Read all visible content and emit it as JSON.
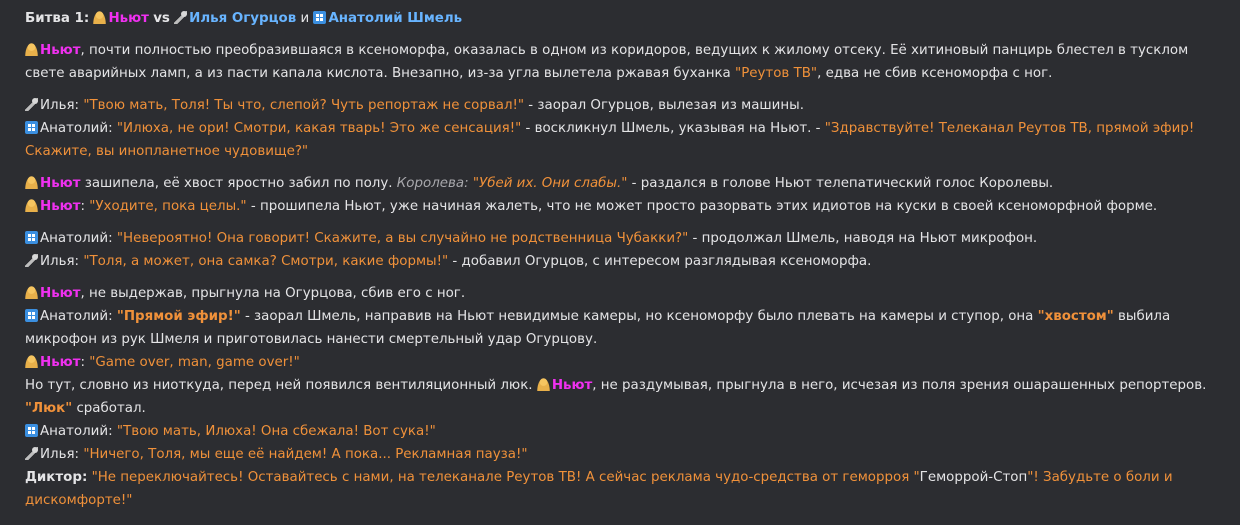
{
  "header": {
    "battle_label": "Битва 1:",
    "name1": "Ньют",
    "vs": "vs",
    "name2": "Илья Огурцов",
    "and": "и",
    "name3": "Анатолий Шмель"
  },
  "icons": {
    "woman": "woman-icon",
    "mic": "microphone-icon",
    "camera": "camera-icon"
  },
  "colors": {
    "background": "#2c2d31",
    "text": "#e4e4e6",
    "nyut": "#f030f0",
    "blue": "#68b4ff",
    "quote": "#f0913a",
    "gray": "#a8a8ac"
  },
  "lines": {
    "l1": {
      "name": "Ньют",
      "text": ", почти полностью преобразившаяся в ксеноморфа, оказалась в одном из коридоров, ведущих к жилому отсеку. Её хитиновый панцирь блестел в тусклом свете аварийных ламп, а из пасти капала кислота. Внезапно, из-за угла вылетела ржавая буханка ",
      "q1": "\"Реутов ТВ\"",
      "text2": ", едва не сбив ксеноморфа с ног."
    },
    "l2": {
      "sp": "Илья:",
      "q1": "\"Твою мать, Толя! Ты что, слепой? Чуть репортаж не сорвал!\"",
      "text": " - заорал Огурцов, вылезая из машины."
    },
    "l3": {
      "sp": "Анатолий:",
      "q1": "\"Илюха, не ори! Смотри, какая тварь! Это же сенсация!\"",
      "text": " - воскликнул Шмель, указывая на Ньют. - ",
      "q2": "\"Здравствуйте! Телеканал Реутов ТВ, прямой эфир! Скажите, вы инопланетное чудовище?\""
    },
    "l4": {
      "name": "Ньют",
      "text": " зашипела, её хвост яростно забил по полу. ",
      "queen": "Королева:",
      "q1": "\"Убей их. Они слабы.\"",
      "text2": " - раздался в голове Ньют телепатический голос Королевы."
    },
    "l5": {
      "name": "Ньют",
      "colon": ":",
      "q1": "\"Уходите, пока целы.\"",
      "text": " - прошипела Ньют, уже начиная жалеть, что не может просто разорвать этих идиотов на куски в своей ксеноморфной форме."
    },
    "l6": {
      "sp": "Анатолий:",
      "q1": "\"Невероятно! Она говорит! Скажите, а вы случайно не родственница Чубакки?\"",
      "text": " - продолжал Шмель, наводя на Ньют микрофон."
    },
    "l7": {
      "sp": "Илья:",
      "q1": "\"Толя, а может, она самка? Смотри, какие формы!\"",
      "text": " - добавил Огурцов, с интересом разглядывая ксеноморфа."
    },
    "l8": {
      "name": "Ньют",
      "text": ", не выдержав, прыгнула на Огурцова, сбив его с ног."
    },
    "l9": {
      "sp": "Анатолий:",
      "q1": "\"Прямой эфир!\"",
      "text": " - заорал Шмель, направив на Ньют невидимые камеры, но ксеноморфу было плевать на камеры и ступор, она ",
      "q2": "\"хвостом\"",
      "text2": " выбила микрофон из рук Шмеля и приготовилась нанести смертельный удар Огурцову."
    },
    "l10": {
      "name": "Ньют",
      "colon": ":",
      "q1": "\"Game over, man, game over!\""
    },
    "l11": {
      "text": "Но тут, словно из ниоткуда, перед ней появился вентиляционный люк. ",
      "name": "Ньют",
      "text2": ", не раздумывая, прыгнула в него, исчезая из поля зрения ошарашенных репортеров. ",
      "q1": "\"Люк\"",
      "text3": " сработал."
    },
    "l12": {
      "sp": "Анатолий:",
      "q1": "\"Твою мать, Илюха! Она сбежала! Вот сука!\""
    },
    "l13": {
      "sp": "Илья:",
      "q1": "\"Ничего, Толя, мы еще её найдем! А пока... Рекламная пауза!\""
    },
    "l14": {
      "sp": "Диктор:",
      "q1": "\"Не переключайтесь! Оставайтесь с нами, на телеканале Реутов ТВ! А сейчас реклама чудо-средства от геморроя \"",
      "brand": "Геморрой-Стоп",
      "q2": "\"! Забудьте о боли и дискомфорте!\""
    }
  }
}
